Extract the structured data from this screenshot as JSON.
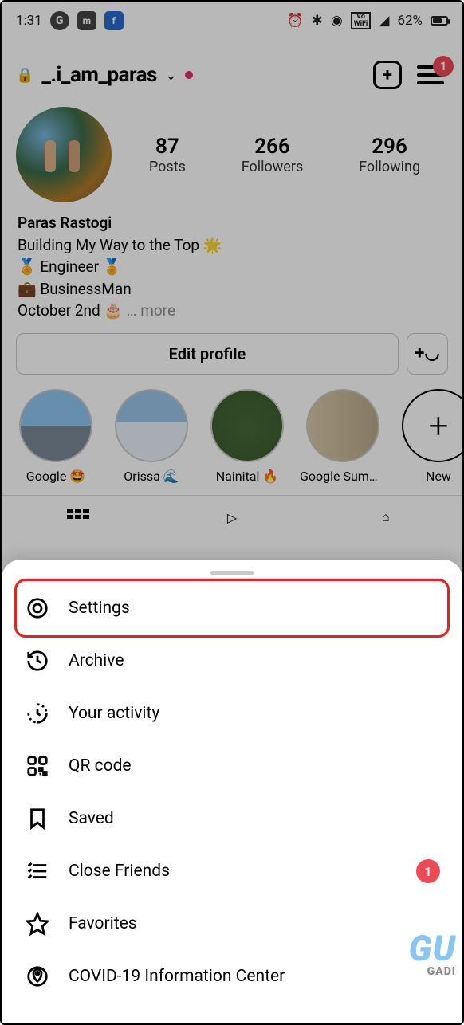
{
  "status_bar": {
    "time": "1:31",
    "battery": "62%"
  },
  "profile_header": {
    "username": "_.i_am_paras",
    "menu_badge": "1"
  },
  "stats": {
    "posts": {
      "num": "87",
      "label": "Posts"
    },
    "followers": {
      "num": "266",
      "label": "Followers"
    },
    "following": {
      "num": "296",
      "label": "Following"
    }
  },
  "bio": {
    "name": "Paras Rastogi",
    "line1": "Building My Way to the Top 🌟",
    "line2": "🏅 Engineer 🏅",
    "line3": "💼 BusinessMan",
    "line4": "October 2nd 🎂",
    "more": "… more"
  },
  "buttons": {
    "edit_profile": "Edit profile"
  },
  "highlights": [
    {
      "label": "Google 🤩"
    },
    {
      "label": "Orissa 🌊"
    },
    {
      "label": "Nainital 🔥"
    },
    {
      "label": "Google Summi…"
    },
    {
      "label": "New"
    }
  ],
  "sheet": {
    "items": [
      {
        "label": "Settings",
        "icon": "gear-icon",
        "highlighted": true
      },
      {
        "label": "Archive",
        "icon": "history-icon"
      },
      {
        "label": "Your activity",
        "icon": "activity-icon"
      },
      {
        "label": "QR code",
        "icon": "qrcode-icon"
      },
      {
        "label": "Saved",
        "icon": "bookmark-icon"
      },
      {
        "label": "Close Friends",
        "icon": "close-friends-icon",
        "badge": "1"
      },
      {
        "label": "Favorites",
        "icon": "star-icon"
      },
      {
        "label": "COVID-19 Information Center",
        "icon": "covid-icon"
      }
    ]
  },
  "watermark": {
    "brand": "GADI",
    "logo": "GU"
  }
}
